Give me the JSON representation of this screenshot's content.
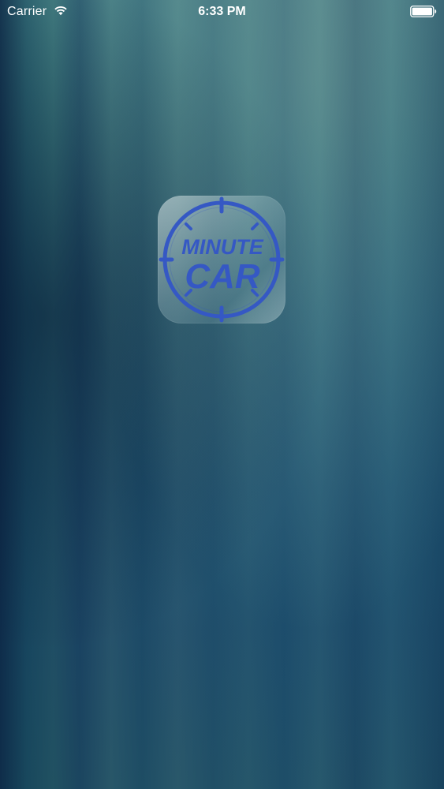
{
  "status_bar": {
    "carrier": "Carrier",
    "time": "6:33 PM",
    "wifi_icon": "wifi-icon",
    "battery_icon": "battery-icon"
  },
  "app_icon": {
    "line1": "MINUTE",
    "line2": "CAR",
    "icon": "stopwatch-icon",
    "brand_color": "#3558c4"
  }
}
